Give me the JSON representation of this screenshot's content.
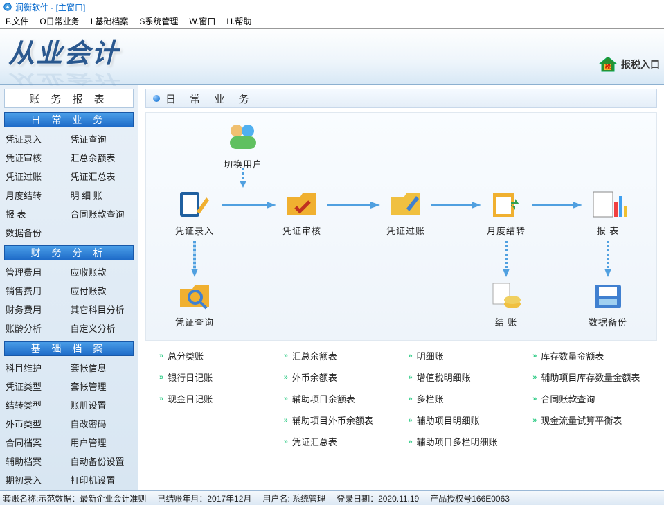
{
  "title_bar": "润衡软件 - [主窗口]",
  "menu": [
    "F.文件",
    "O日常业务",
    "I 基础档案",
    "S系统管理",
    "W.窗口",
    "H.帮助"
  ],
  "logo_text": "从业会计",
  "tax_link": "报税入口",
  "sidebar": {
    "panel_title": "账 务 报 表",
    "sections": [
      {
        "title": "日 常 业 务",
        "items": [
          "凭证录入",
          "凭证查询",
          "凭证审核",
          "汇总余额表",
          "凭证过账",
          "凭证汇总表",
          "月度结转",
          "明 细 账",
          "报   表",
          "合同账款查询",
          "数据备份",
          ""
        ]
      },
      {
        "title": "财 务 分 析",
        "items": [
          "管理费用",
          "应收账款",
          "销售费用",
          "应付账款",
          "财务费用",
          "其它科目分析",
          "账龄分析",
          "自定义分析"
        ]
      },
      {
        "title": "基 础 档 案",
        "items": [
          "科目维护",
          "套帐信息",
          "凭证类型",
          "套帐管理",
          "结转类型",
          "账册设置",
          "外币类型",
          "自改密码",
          "合同档案",
          "用户管理",
          "辅助档案",
          "自动备份设置",
          "期初录入",
          "打印机设置"
        ]
      }
    ]
  },
  "content": {
    "title": "日 常 业 务",
    "nodes": {
      "switch_user": "切换用户",
      "entry": "凭证录入",
      "audit": "凭证审核",
      "post": "凭证过账",
      "month": "月度结转",
      "report": "报  表",
      "query": "凭证查询",
      "close": "结  账",
      "backup": "数据备份"
    },
    "quick_links": [
      "总分类账",
      "汇总余额表",
      "明细账",
      "库存数量金额表",
      "银行日记账",
      "外币余额表",
      "增值税明细账",
      "辅助项目库存数量金额表",
      "现金日记账",
      "辅助项目余额表",
      "多栏账",
      "合同账款查询",
      "",
      "辅助项目外币余额表",
      "辅助项目明细账",
      "现金流量试算平衡表",
      "",
      "凭证汇总表",
      "辅助项目多栏明细账",
      ""
    ]
  },
  "status": {
    "s1": "套账名称:示范数据：最新企业会计准则",
    "s2": "已结账年月：2017年12月",
    "s3": "用户名: 系统管理",
    "s4": "登录日期：2020.11.19",
    "s5": "产品授权号166E0063"
  }
}
